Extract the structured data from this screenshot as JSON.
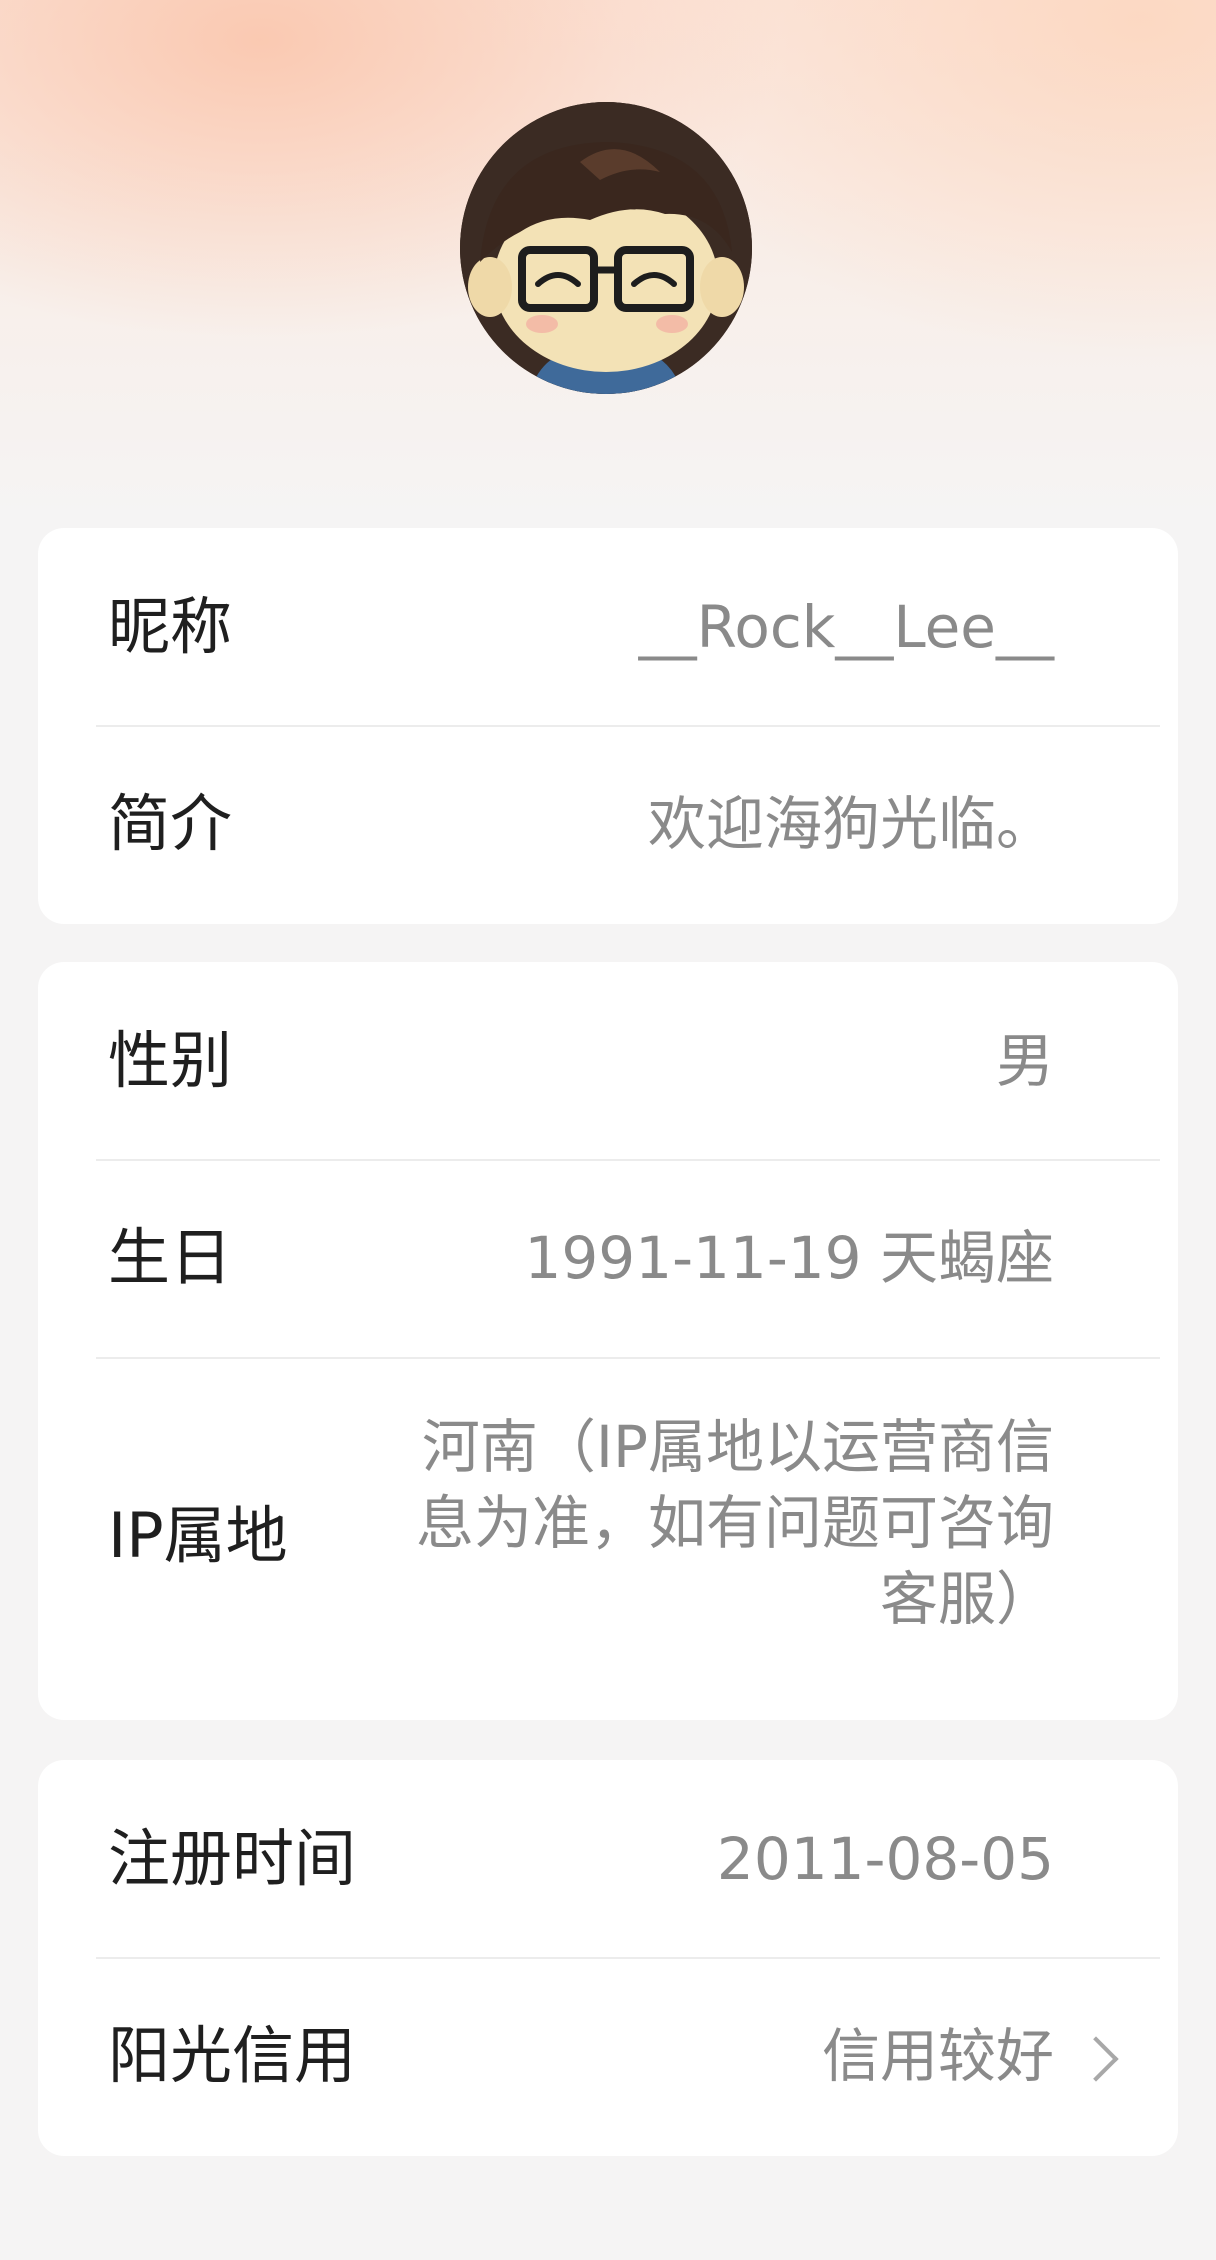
{
  "profile": {
    "avatar_icon": "avatar-cartoon-boy-glasses-icon"
  },
  "basic": {
    "nickname_label": "昵称",
    "nickname_value": "__Rock__Lee__",
    "intro_label": "简介",
    "intro_value": "欢迎海狗光临。"
  },
  "personal": {
    "gender_label": "性别",
    "gender_value": "男",
    "birthday_label": "生日",
    "birthday_value": "1991-11-19 天蝎座",
    "ip_label": "IP属地",
    "ip_value": "河南（IP属地以运营商信息为准，如有问题可咨询客服）"
  },
  "account": {
    "register_label": "注册时间",
    "register_value": "2011-08-05",
    "credit_label": "阳光信用",
    "credit_value": "信用较好",
    "credit_icon": "chevron-right-icon"
  }
}
